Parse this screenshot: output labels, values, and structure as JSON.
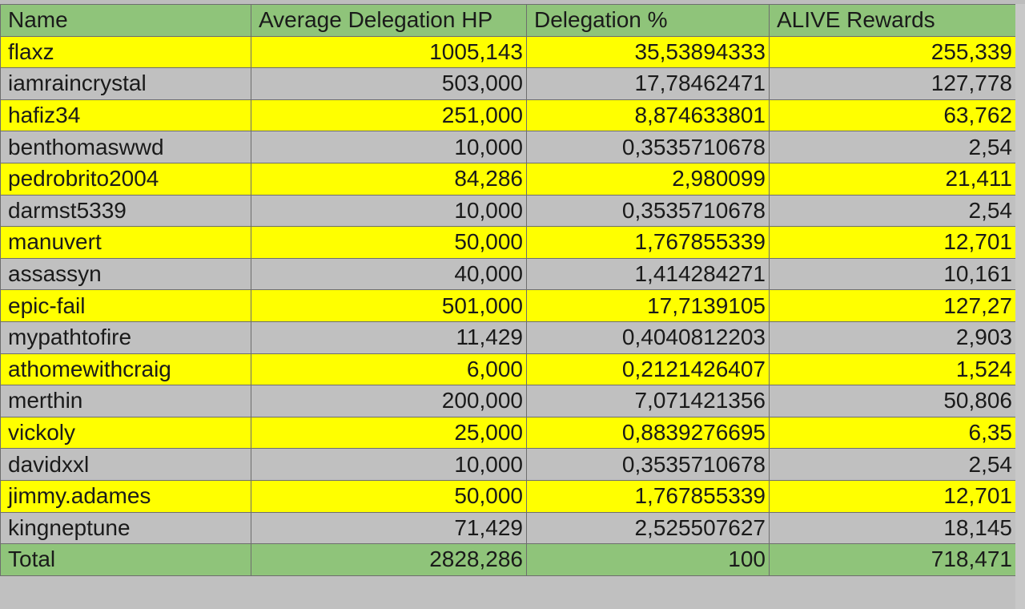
{
  "table": {
    "headers": [
      "Name",
      "Average Delegation HP",
      "Delegation %",
      "ALIVE Rewards"
    ],
    "rows": [
      {
        "name": "flaxz",
        "hp": "1005,143",
        "pct": "35,53894333",
        "rewards": "255,339",
        "highlight": "yellow"
      },
      {
        "name": "iamraincrystal",
        "hp": "503,000",
        "pct": "17,78462471",
        "rewards": "127,778",
        "highlight": "gray"
      },
      {
        "name": "hafiz34",
        "hp": "251,000",
        "pct": "8,874633801",
        "rewards": "63,762",
        "highlight": "yellow"
      },
      {
        "name": "benthomaswwd",
        "hp": "10,000",
        "pct": "0,3535710678",
        "rewards": "2,54",
        "highlight": "gray"
      },
      {
        "name": "pedrobrito2004",
        "hp": "84,286",
        "pct": "2,980099",
        "rewards": "21,411",
        "highlight": "yellow"
      },
      {
        "name": "darmst5339",
        "hp": "10,000",
        "pct": "0,3535710678",
        "rewards": "2,54",
        "highlight": "gray"
      },
      {
        "name": "manuvert",
        "hp": "50,000",
        "pct": "1,767855339",
        "rewards": "12,701",
        "highlight": "yellow"
      },
      {
        "name": "assassyn",
        "hp": "40,000",
        "pct": "1,414284271",
        "rewards": "10,161",
        "highlight": "gray"
      },
      {
        "name": "epic-fail",
        "hp": "501,000",
        "pct": "17,7139105",
        "rewards": "127,27",
        "highlight": "yellow"
      },
      {
        "name": "mypathtofire",
        "hp": "11,429",
        "pct": "0,4040812203",
        "rewards": "2,903",
        "highlight": "gray"
      },
      {
        "name": "athomewithcraig",
        "hp": "6,000",
        "pct": "0,2121426407",
        "rewards": "1,524",
        "highlight": "yellow"
      },
      {
        "name": "merthin",
        "hp": "200,000",
        "pct": "7,071421356",
        "rewards": "50,806",
        "highlight": "gray"
      },
      {
        "name": "vickoly",
        "hp": "25,000",
        "pct": "0,8839276695",
        "rewards": "6,35",
        "highlight": "yellow"
      },
      {
        "name": "davidxxl",
        "hp": "10,000",
        "pct": "0,3535710678",
        "rewards": "2,54",
        "highlight": "gray"
      },
      {
        "name": "jimmy.adames",
        "hp": "50,000",
        "pct": "1,767855339",
        "rewards": "12,701",
        "highlight": "yellow"
      },
      {
        "name": "kingneptune",
        "hp": "71,429",
        "pct": "2,525507627",
        "rewards": "18,145",
        "highlight": "gray"
      }
    ],
    "total": {
      "label": "Total",
      "hp": "2828,286",
      "pct": "100",
      "rewards": "718,471"
    }
  },
  "colors": {
    "header_green": "#8fc47a",
    "row_yellow": "#ffff00",
    "row_gray": "#c0c0c0"
  }
}
